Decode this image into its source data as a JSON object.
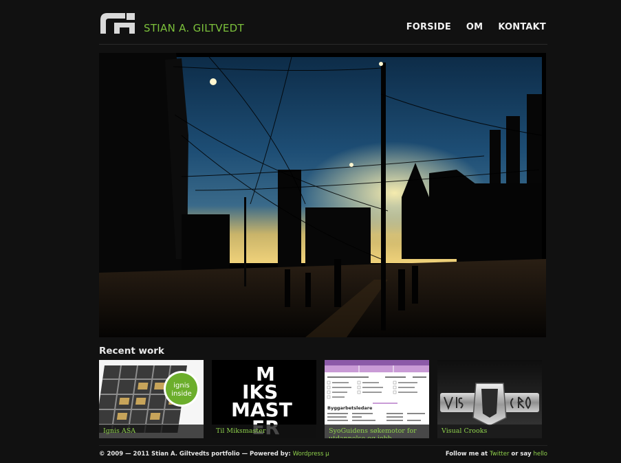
{
  "header": {
    "logo_icon": "ga-logo-icon",
    "site_title": "STIAN A. GILTVEDT",
    "nav": [
      {
        "label": "FORSIDE"
      },
      {
        "label": "OM"
      },
      {
        "label": "KONTAKT"
      }
    ]
  },
  "hero": {
    "image": "night-city-street-photo"
  },
  "recent": {
    "title": "Recent work",
    "items": [
      {
        "caption": "Ignis ASA",
        "badge_line1": "ignis",
        "badge_line2": "inside"
      },
      {
        "caption": "Til Miksmaster",
        "logo_lines": [
          "M",
          "IKS",
          "MAST",
          "ER"
        ]
      },
      {
        "caption": "SyoGuidens søkemotor for utdannelse og jobb",
        "box_title": "Byggarbetsledare"
      },
      {
        "caption": "Visual Crooks"
      }
    ]
  },
  "footer": {
    "left_text": "© 2009 — 2011 Stian A. Giltvedts portfolio — Powered by: ",
    "powered_link": "Wordpress µ",
    "right_text": "Follow me at ",
    "twitter_link": "Twitter",
    "or_say": " or say ",
    "hello_link": "hello"
  },
  "colors": {
    "accent": "#7cc13b",
    "background": "#111111"
  }
}
